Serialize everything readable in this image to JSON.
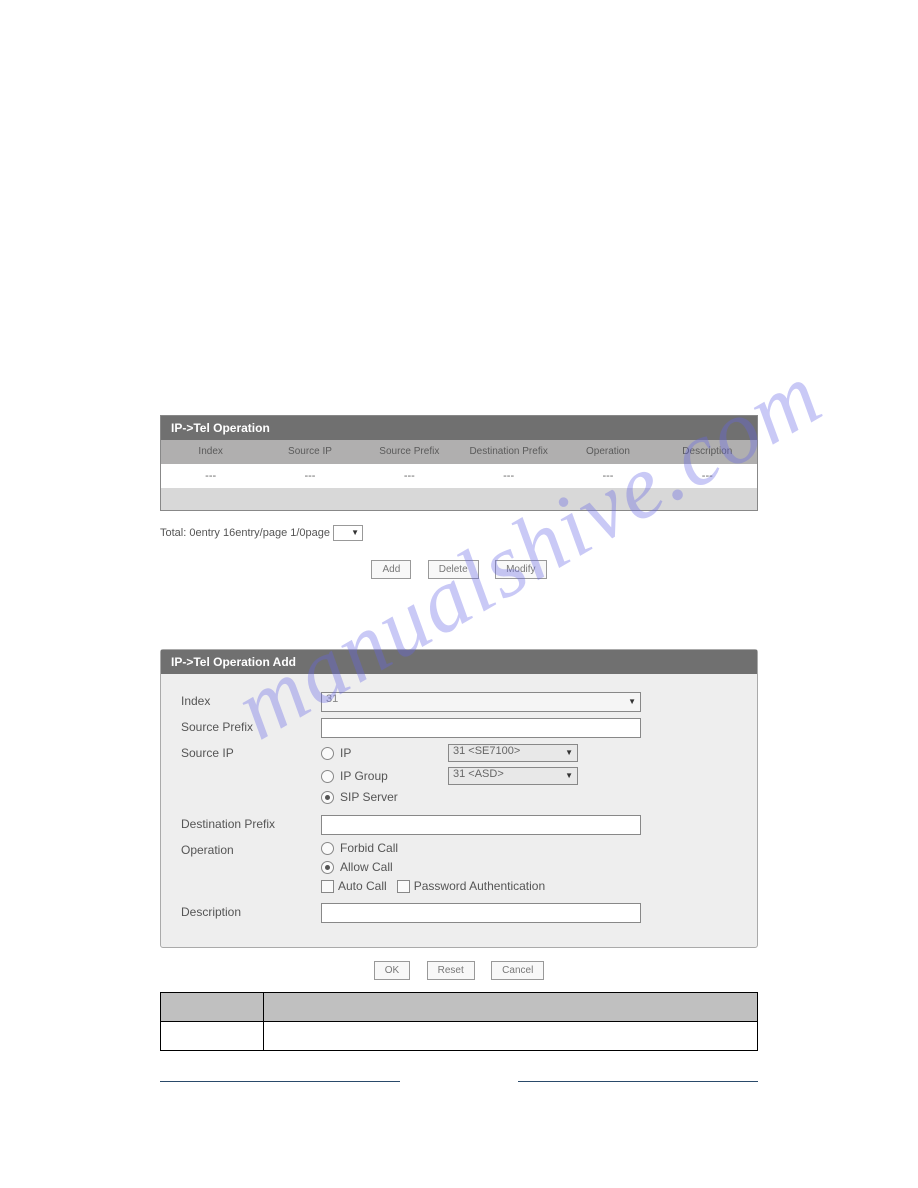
{
  "watermark": "manualshive.com",
  "panel1": {
    "title": "IP->Tel Operation",
    "headers": [
      "Index",
      "Source IP",
      "Source Prefix",
      "Destination Prefix",
      "Operation",
      "Description"
    ],
    "row": [
      "---",
      "---",
      "---",
      "---",
      "---",
      "---"
    ],
    "pager_text": "Total: 0entry  16entry/page  1/0page",
    "buttons": {
      "add": "Add",
      "delete": "Delete",
      "modify": "Modify"
    }
  },
  "panel2": {
    "title": "IP->Tel Operation Add",
    "labels": {
      "index": "Index",
      "source_prefix": "Source Prefix",
      "source_ip": "Source IP",
      "dest_prefix": "Destination Prefix",
      "operation": "Operation",
      "description": "Description"
    },
    "index_value": "31",
    "source_ip": {
      "opt_ip": "IP",
      "opt_ip_group": "IP Group",
      "opt_sip_server": "SIP Server",
      "ip_select": "31 <SE7100>",
      "ipgroup_select": "31 <ASD>"
    },
    "operation": {
      "forbid": "Forbid Call",
      "allow": "Allow Call",
      "auto": "Auto Call",
      "password": "Password Authentication"
    },
    "buttons": {
      "ok": "OK",
      "reset": "Reset",
      "cancel": "Cancel"
    }
  }
}
